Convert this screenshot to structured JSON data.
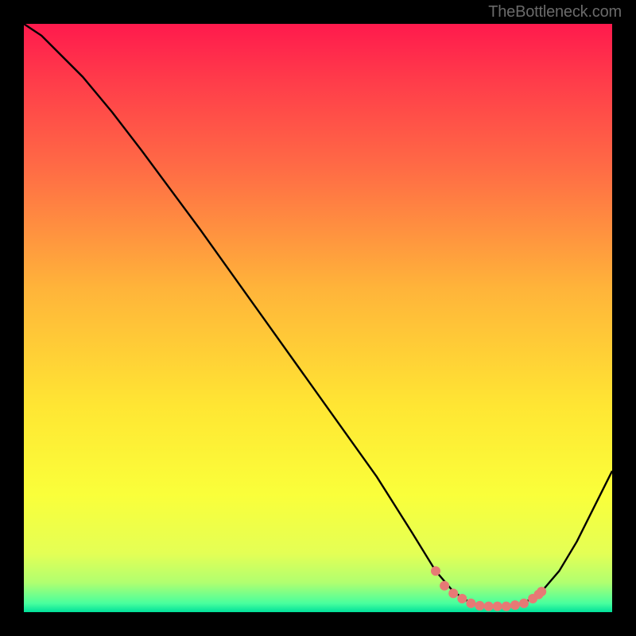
{
  "attribution": "TheBottleneck.com",
  "colors": {
    "background": "#000000",
    "curve": "#000000",
    "marker": "#e77975",
    "attribution": "#6a6a6a"
  },
  "chart_data": {
    "type": "line",
    "title": "",
    "xlabel": "",
    "ylabel": "",
    "xlim": [
      0,
      100
    ],
    "ylim": [
      0,
      100
    ],
    "grid": false,
    "background_gradient": {
      "type": "vertical",
      "stops": [
        {
          "pos": 0.0,
          "color": "#ff1a4d"
        },
        {
          "pos": 0.1,
          "color": "#ff3d4a"
        },
        {
          "pos": 0.25,
          "color": "#ff6d45"
        },
        {
          "pos": 0.45,
          "color": "#ffb43a"
        },
        {
          "pos": 0.65,
          "color": "#ffe633"
        },
        {
          "pos": 0.8,
          "color": "#faff3a"
        },
        {
          "pos": 0.9,
          "color": "#e4ff55"
        },
        {
          "pos": 0.95,
          "color": "#b0ff70"
        },
        {
          "pos": 0.985,
          "color": "#49ff9e"
        },
        {
          "pos": 1.0,
          "color": "#00e09a"
        }
      ]
    },
    "series": [
      {
        "name": "bottleneck-curve",
        "x": [
          0,
          3,
          6,
          10,
          15,
          20,
          30,
          40,
          50,
          60,
          66,
          70,
          73,
          76,
          79,
          82,
          85,
          88,
          91,
          94,
          100
        ],
        "y": [
          100,
          98,
          95,
          91,
          85,
          78.5,
          65,
          51,
          37,
          23,
          13.5,
          7,
          3.5,
          1.5,
          1,
          1,
          1.5,
          3.5,
          7,
          12,
          24
        ]
      }
    ],
    "markers": {
      "name": "optimal-range",
      "color": "#e77975",
      "points": [
        {
          "x": 70,
          "y": 7
        },
        {
          "x": 71.5,
          "y": 4.5
        },
        {
          "x": 73,
          "y": 3.2
        },
        {
          "x": 74.5,
          "y": 2.3
        },
        {
          "x": 76,
          "y": 1.5
        },
        {
          "x": 77.5,
          "y": 1.1
        },
        {
          "x": 79,
          "y": 1.0
        },
        {
          "x": 80.5,
          "y": 1.0
        },
        {
          "x": 82,
          "y": 1.0
        },
        {
          "x": 83.5,
          "y": 1.2
        },
        {
          "x": 85,
          "y": 1.5
        },
        {
          "x": 86.5,
          "y": 2.3
        },
        {
          "x": 87.5,
          "y": 3.0
        },
        {
          "x": 88,
          "y": 3.5
        }
      ]
    }
  }
}
